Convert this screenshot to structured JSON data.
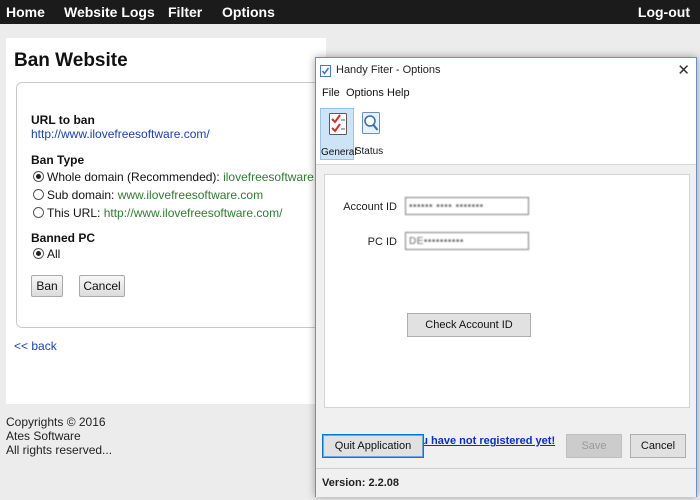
{
  "nav": {
    "items": [
      "Home",
      "Website Logs",
      "Filter",
      "Options"
    ],
    "logout": "Log-out"
  },
  "page": {
    "title": "Ban Website",
    "url_label": "URL to ban",
    "url_value": "http://www.ilovefreesoftware.com/",
    "ban_type_label": "Ban Type",
    "ban_options": [
      {
        "label": "Whole domain (Recommended): ",
        "value": "ilovefreesoftware.com",
        "checked": true
      },
      {
        "label": "Sub domain: ",
        "value": "www.ilovefreesoftware.com",
        "checked": false
      },
      {
        "label": "This URL: ",
        "value": "http://www.ilovefreesoftware.com/",
        "checked": false
      }
    ],
    "banned_pc_label": "Banned PC",
    "banned_pc_option": "All",
    "ban_button": "Ban",
    "cancel_button": "Cancel",
    "back_link": "<< back",
    "footer": [
      "Copyrights © 2016",
      "Ates Software",
      "All rights reserved..."
    ]
  },
  "dialog": {
    "title": "Handy Fiter - Options",
    "menu": [
      "File",
      "Options",
      "Help"
    ],
    "tabs": [
      {
        "label": "General",
        "icon": "checklist-icon",
        "selected": true
      },
      {
        "label": "Status",
        "icon": "magnifier-icon",
        "selected": false
      }
    ],
    "account_id_label": "Account ID",
    "account_id_value": "•••••• •••• •••••••",
    "pc_id_label": "PC ID",
    "pc_id_value": "DE••••••••••",
    "check_button": "Check Account ID",
    "register_link": "Click here if you have not registered yet!",
    "quit_button": "Quit Application",
    "save_button": "Save",
    "cancel_button": "Cancel",
    "version": "Version: 2.2.08"
  },
  "colors": {
    "nav_bg": "#1b1b1b",
    "link_blue": "#1a3fb5",
    "link_green": "#2e7d32",
    "dialog_accent": "#0078d7"
  }
}
